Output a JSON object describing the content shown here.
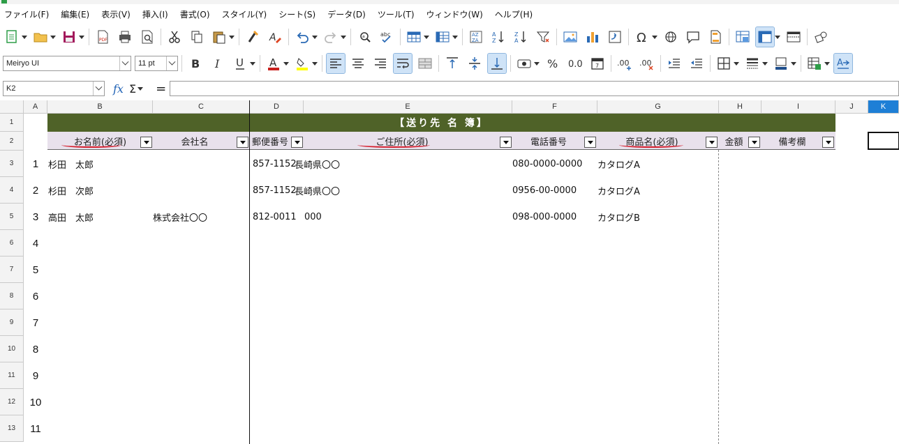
{
  "menu": [
    "ファイル(F)",
    "編集(E)",
    "表示(V)",
    "挿入(I)",
    "書式(O)",
    "スタイル(Y)",
    "シート(S)",
    "データ(D)",
    "ツール(T)",
    "ウィンドウ(W)",
    "ヘルプ(H)"
  ],
  "font": {
    "name": "Meiryo UI",
    "size": "11 pt"
  },
  "namebox": "K2",
  "formula": "",
  "columns": [
    "A",
    "B",
    "C",
    "D",
    "E",
    "F",
    "G",
    "H",
    "I",
    "J",
    "K"
  ],
  "rows": [
    "1",
    "2",
    "3",
    "4",
    "5",
    "6",
    "7",
    "8",
    "9",
    "10",
    "11",
    "12",
    "13"
  ],
  "sheet": {
    "title": "【送り先 名 簿】",
    "headers": {
      "name": "お名前(必須)",
      "company": "会社名",
      "zip": "郵便番号",
      "address": "ご住所(必須)",
      "phone": "電話番号",
      "product": "商品名(必須)",
      "amount": "金額",
      "notes": "備考欄"
    },
    "records": [
      {
        "no": "1",
        "name": "杉田　太郎",
        "company": "",
        "zip": "857-1152",
        "address": "長崎県〇〇",
        "phone": "080-0000-0000",
        "product": "カタログA"
      },
      {
        "no": "2",
        "name": "杉田　次郎",
        "company": "",
        "zip": "857-1152",
        "address": "長崎県〇〇",
        "phone": "0956-00-0000",
        "product": "カタログA"
      },
      {
        "no": "3",
        "name": "高田　太郎",
        "company": "株式会社〇〇",
        "zip": "812-0011",
        "address": "000",
        "phone": "098-000-0000",
        "product": "カタログB"
      }
    ],
    "extra_numbers": [
      "4",
      "5",
      "6",
      "7",
      "8",
      "9",
      "10",
      "11"
    ]
  },
  "colors": {
    "title_band": "#4f6228",
    "header_band": "#e8e1ec",
    "selection": "#1e7fd6",
    "annotation": "#d41c2b"
  }
}
